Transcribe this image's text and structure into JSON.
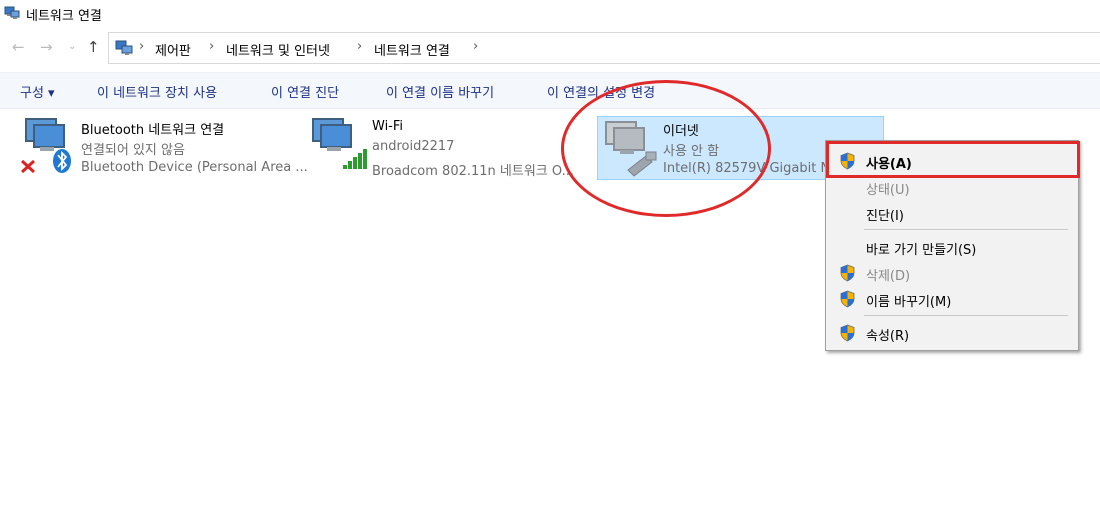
{
  "window": {
    "title": "네트워크 연결"
  },
  "nav": {
    "back_icon": "back-arrow-icon",
    "forward_icon": "forward-arrow-icon",
    "recent_icon": "chevron-down-icon",
    "up_icon": "up-arrow-icon"
  },
  "address": {
    "crumbs": [
      "제어판",
      "네트워크 및 인터넷",
      "네트워크 연결"
    ],
    "separator": "›"
  },
  "commands": {
    "organize": "구성 ▾",
    "disable": "이 네트워크 장치 사용",
    "diagnose": "이 연결 진단",
    "rename": "이 연결 이름 바꾸기",
    "settings": "이 연결의 설정 변경"
  },
  "adapters": [
    {
      "name": "Bluetooth 네트워크 연결",
      "status": "연결되어 있지 않음",
      "device": "Bluetooth Device (Personal Area ..."
    },
    {
      "name": "Wi-Fi",
      "status": "android2217",
      "device": "Broadcom 802.11n 네트워크 O..."
    },
    {
      "name": "이더넷",
      "status": "사용 안 함",
      "device": "Intel(R) 82579V Gigabit N..."
    }
  ],
  "context_menu": {
    "items": [
      {
        "label": "사용(A)",
        "shield": true,
        "bold": true,
        "disabled": false
      },
      {
        "label": "상태(U)",
        "shield": false,
        "bold": false,
        "disabled": true
      },
      {
        "label": "진단(I)",
        "shield": false,
        "bold": false,
        "disabled": false
      },
      {
        "label": "바로 가기 만들기(S)",
        "shield": false,
        "bold": false,
        "disabled": false
      },
      {
        "label": "삭제(D)",
        "shield": true,
        "bold": false,
        "disabled": true
      },
      {
        "label": "이름 바꾸기(M)",
        "shield": true,
        "bold": false,
        "disabled": false
      },
      {
        "label": "속성(R)",
        "shield": true,
        "bold": false,
        "disabled": false
      }
    ]
  },
  "colors": {
    "highlight": "#e02a2a",
    "selection": "#cce8ff",
    "command_text": "#1e3287"
  }
}
